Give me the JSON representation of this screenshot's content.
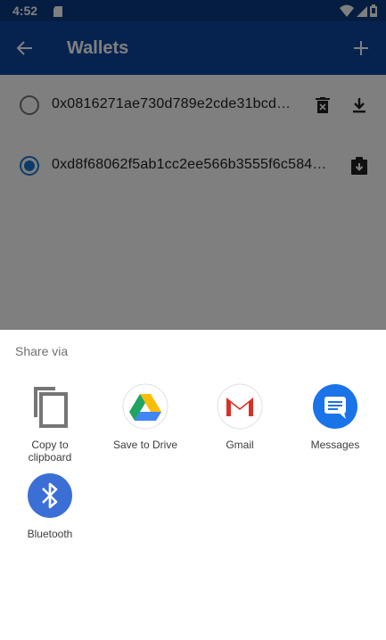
{
  "status_bar": {
    "time": "4:52"
  },
  "app_bar": {
    "title": "Wallets"
  },
  "wallets": [
    {
      "address": "0x0816271ae730d789e2cde31bcd…",
      "selected": false
    },
    {
      "address": "0xd8f68062f5ab1cc2ee566b3555f6c584…",
      "selected": true
    }
  ],
  "share_sheet": {
    "title": "Share via",
    "targets": [
      {
        "label": "Copy to\nclipboard",
        "icon": "copy-icon"
      },
      {
        "label": "Save to Drive",
        "icon": "google-drive-icon"
      },
      {
        "label": "Gmail",
        "icon": "gmail-icon"
      },
      {
        "label": "Messages",
        "icon": "messages-icon"
      },
      {
        "label": "Bluetooth",
        "icon": "bluetooth-icon"
      }
    ]
  },
  "colors": {
    "status_bar": "#0a3a82",
    "app_bar": "#0d47a1",
    "radio_selected": "#1976d2",
    "scrim": "rgba(0,0,0,0.5)"
  }
}
